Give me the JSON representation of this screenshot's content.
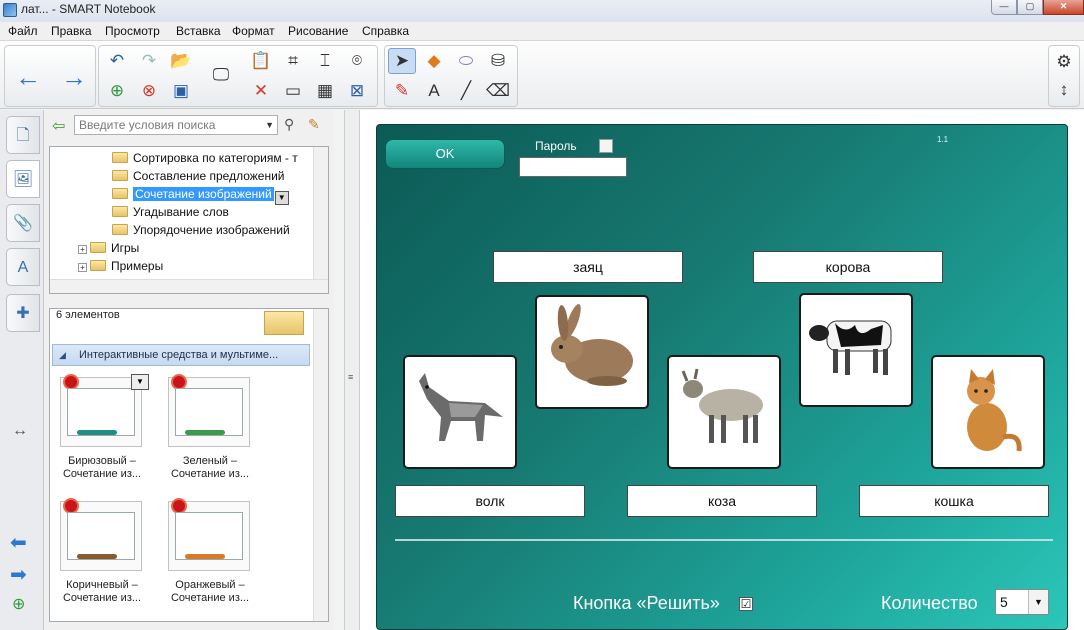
{
  "window": {
    "title": "лат... - SMART Notebook"
  },
  "menu": [
    "Файл",
    "Правка",
    "Просмотр",
    "Вставка",
    "Формат",
    "Рисование",
    "Справка"
  ],
  "search": {
    "placeholder": "Введите условия поиска"
  },
  "tree": {
    "items": [
      {
        "label": "Сортировка по категориям - т"
      },
      {
        "label": "Составление предложений"
      },
      {
        "label": "Сочетание изображений"
      },
      {
        "label": "Угадывание слов"
      },
      {
        "label": "Упорядочение изображений"
      },
      {
        "label": "Игры"
      },
      {
        "label": "Примеры"
      }
    ]
  },
  "gallery": {
    "count": "6 элементов",
    "category": "Интерактивные средства и мультиме...",
    "thumbs": [
      {
        "label": "Бирюзовый – Сочетание из...",
        "accent": "#1f8f83"
      },
      {
        "label": "Зеленый – Сочетание из...",
        "accent": "#3d9a4a"
      },
      {
        "label": "Коричневый – Сочетание из...",
        "accent": "#8a5a2e"
      },
      {
        "label": "Оранжевый – Сочетание из...",
        "accent": "#d97a2a"
      }
    ]
  },
  "board": {
    "ok_label": "OK",
    "password_label": "Пароль",
    "version": "1.1",
    "words": [
      "заяц",
      "корова",
      "волк",
      "коза",
      "кошка"
    ],
    "animals": {
      "rabbit": "rabbit-picture",
      "cow": "cow-picture",
      "wolf": "wolf-picture",
      "goat": "goat-picture",
      "cat": "cat-picture"
    },
    "solve_label": "Кнопка «Решить»",
    "solve_checked": "☑",
    "count_label": "Количество",
    "count_value": "5"
  },
  "colors": {
    "board_dark": "#0c5a56",
    "board_light": "#2bc7b9",
    "selection": "#3399ff"
  }
}
